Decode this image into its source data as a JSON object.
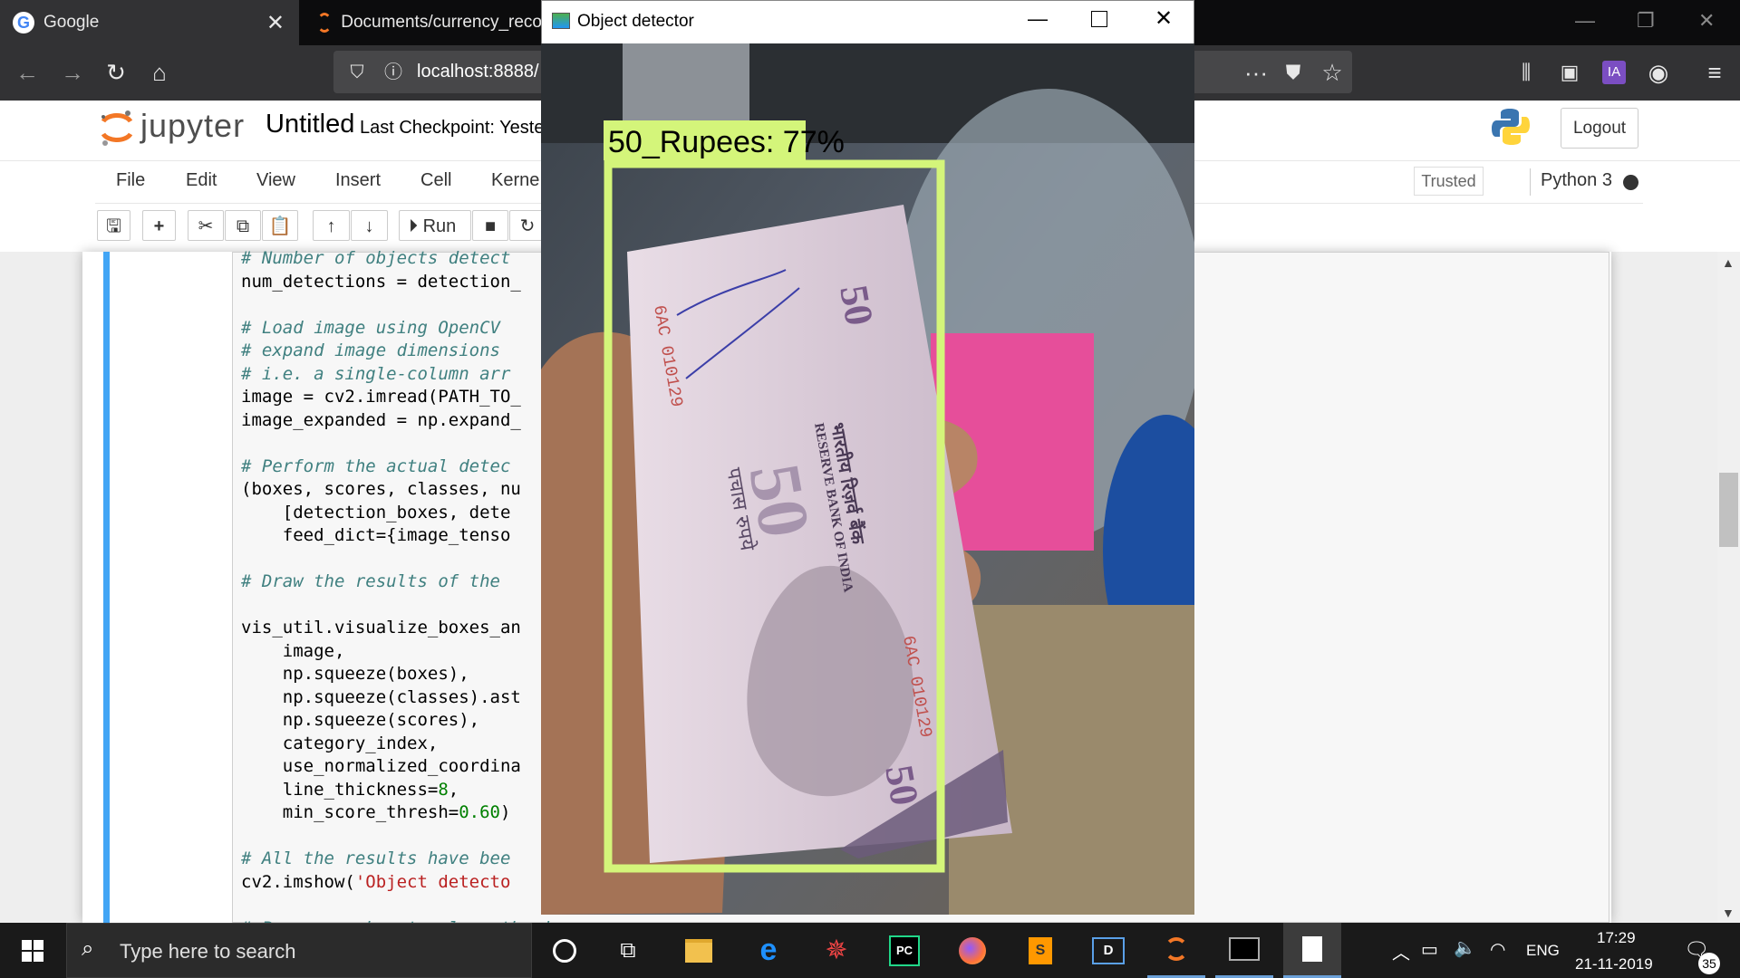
{
  "browser": {
    "tabs": [
      {
        "label": "Google",
        "close": "✕"
      },
      {
        "label": "Documents/currency_reco"
      }
    ],
    "url": "localhost:8888/"
  },
  "jupyter": {
    "logo_text": "jupyter",
    "notebook_title": "Untitled",
    "checkpoint": "Last Checkpoint: Yeste",
    "logout_label": "Logout",
    "menu": [
      "File",
      "Edit",
      "View",
      "Insert",
      "Cell",
      "Kerne"
    ],
    "trusted": "Trusted",
    "kernel": "Python 3",
    "toolbar": {
      "run_label": "Run"
    }
  },
  "code_lines": [
    {
      "text": "# Number of objects detect",
      "kind": "comment"
    },
    {
      "text": "num_detections = detection_",
      "kind": "code"
    },
    {
      "text": "",
      "kind": "code"
    },
    {
      "text": "# Load image using OpenCV ",
      "kind": "comment"
    },
    {
      "text": "# expand image dimensions ",
      "kind": "comment"
    },
    {
      "text": "# i.e. a single-column arr",
      "kind": "comment"
    },
    {
      "text": "image = cv2.imread(PATH_TO_",
      "kind": "code"
    },
    {
      "text": "image_expanded = np.expand_",
      "kind": "code"
    },
    {
      "text": "",
      "kind": "code"
    },
    {
      "text": "# Perform the actual detec",
      "kind": "comment"
    },
    {
      "text": "(boxes, scores, classes, nu",
      "kind": "code"
    },
    {
      "text": "    [detection_boxes, dete",
      "kind": "code"
    },
    {
      "text": "    feed_dict={image_tenso",
      "kind": "code"
    },
    {
      "text": "",
      "kind": "code"
    },
    {
      "text": "# Draw the results of the ",
      "kind": "comment"
    },
    {
      "text": "",
      "kind": "code"
    },
    {
      "text": "vis_util.visualize_boxes_an",
      "kind": "code"
    },
    {
      "text": "    image,",
      "kind": "code"
    },
    {
      "text": "    np.squeeze(boxes),",
      "kind": "code"
    },
    {
      "text": "    np.squeeze(classes).ast",
      "kind": "code"
    },
    {
      "text": "    np.squeeze(scores),",
      "kind": "code"
    },
    {
      "text": "    category_index,",
      "kind": "code"
    },
    {
      "text": "    use_normalized_coordina",
      "kind": "code"
    },
    {
      "text": "    line_thickness=8,",
      "kind": "code"
    },
    {
      "text": "    min_score_thresh=0.60)",
      "kind": "code"
    },
    {
      "text": "",
      "kind": "code"
    },
    {
      "text": "# All the results have bee",
      "kind": "comment"
    },
    {
      "text": "cv2.imshow('Object detecto",
      "kind": "code"
    },
    {
      "text": "",
      "kind": "code"
    },
    {
      "text": "# Press any key to close the image",
      "kind": "comment"
    }
  ],
  "detector": {
    "window_title": "Object detector",
    "label": "50_Rupees: 77%",
    "box_color": "#d4f57a",
    "note_text": {
      "denomination": "50",
      "serial": "6AC 010129",
      "hindi_value": "पचास रुपये",
      "hindi_bank": "भारतीय रिज़र्व बैंक",
      "bank": "RESERVE BANK OF INDIA"
    }
  },
  "taskbar": {
    "search_placeholder": "Type here to search",
    "language": "ENG",
    "time": "17:29",
    "date": "21-11-2019",
    "notifications": "35",
    "apps": [
      "task-view",
      "file-explorer",
      "edge",
      "app-red",
      "pycharm",
      "firefox",
      "sublime-text",
      "app-blue",
      "jupyter",
      "terminal",
      "notepad"
    ]
  },
  "colors": {
    "cell_accent": "#42a5f5",
    "comment": "#408080",
    "string": "#ba2121",
    "number": "#008000"
  }
}
